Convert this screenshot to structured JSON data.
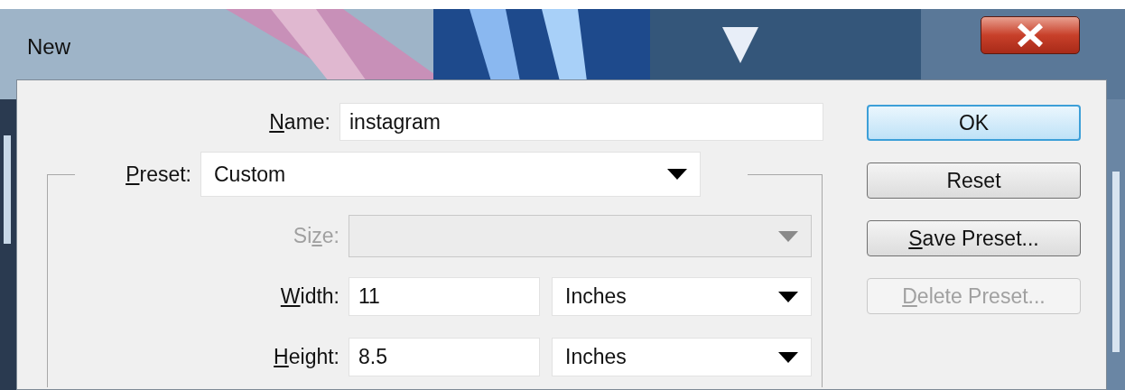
{
  "window": {
    "title": "New"
  },
  "name": {
    "label": "Name:",
    "first_letter_underlined": true,
    "value": "instagram"
  },
  "preset": {
    "label": "Preset:",
    "first_letter_underlined": true,
    "value": "Custom"
  },
  "size": {
    "label": "Size:",
    "third_letter_underlined": true,
    "disabled": true
  },
  "width": {
    "label": "Width:",
    "first_letter_underlined": true,
    "value": "11",
    "unit": "Inches"
  },
  "height": {
    "label": "Height:",
    "first_letter_underlined": true,
    "value": "8.5",
    "unit": "Inches"
  },
  "buttons": [
    {
      "label": "OK",
      "default": true,
      "disabled": false
    },
    {
      "label": "Reset",
      "default": false,
      "disabled": false
    },
    {
      "label": "Save Preset...",
      "first_letter_underlined": true,
      "default": false,
      "disabled": false
    },
    {
      "label": "Delete Preset...",
      "first_letter_underlined": true,
      "default": false,
      "disabled": true
    }
  ]
}
